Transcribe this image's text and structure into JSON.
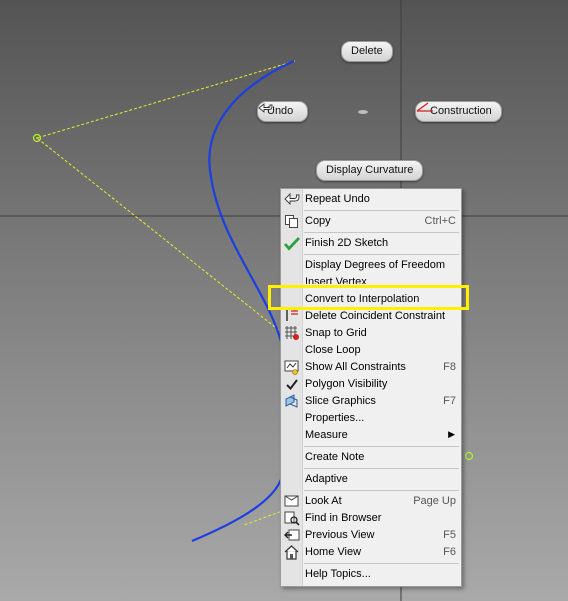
{
  "colors": {
    "curve": "#1b3fe0",
    "construction_line": "#e8ee2a",
    "highlight": "#ffef00",
    "check_green": "#2ea043",
    "construction_icon": "#d22020"
  },
  "marking_menu": {
    "delete": "Delete",
    "undo": "Undo",
    "construction": "Construction",
    "display_curvature": "Display Curvature"
  },
  "context_menu": {
    "items": [
      {
        "label": "Repeat Undo",
        "shortcut": "",
        "icon": "undo-arrow-icon"
      },
      {
        "label": "Copy",
        "shortcut": "Ctrl+C",
        "icon": "copy-icon"
      },
      {
        "label": "Finish 2D Sketch",
        "shortcut": "",
        "icon": "green-check-icon"
      },
      {
        "label": "Display Degrees of Freedom",
        "shortcut": "",
        "icon": ""
      },
      {
        "label": "Insert Vertex",
        "shortcut": "",
        "icon": ""
      },
      {
        "label": "Convert to Interpolation",
        "shortcut": "",
        "icon": ""
      },
      {
        "label": "Delete Coincident Constraint",
        "shortcut": "",
        "icon": "delete-constraint-icon"
      },
      {
        "label": "Snap to Grid",
        "shortcut": "",
        "icon": "snap-grid-icon"
      },
      {
        "label": "Close Loop",
        "shortcut": "",
        "icon": ""
      },
      {
        "label": "Show All Constraints",
        "shortcut": "F8",
        "icon": "show-constraints-icon"
      },
      {
        "label": "Polygon Visibility",
        "shortcut": "",
        "icon": "checkmark-icon"
      },
      {
        "label": "Slice Graphics",
        "shortcut": "F7",
        "icon": "slice-graphics-icon"
      },
      {
        "label": "Properties...",
        "shortcut": "",
        "icon": ""
      },
      {
        "label": "Measure",
        "shortcut": "",
        "icon": "submenu-arrow"
      },
      {
        "label": "Create Note",
        "shortcut": "",
        "icon": ""
      },
      {
        "label": "Adaptive",
        "shortcut": "",
        "icon": ""
      },
      {
        "label": "Look At",
        "shortcut": "Page Up",
        "icon": "look-at-icon"
      },
      {
        "label": "Find in Browser",
        "shortcut": "",
        "icon": "find-in-browser-icon"
      },
      {
        "label": "Previous View",
        "shortcut": "F5",
        "icon": "previous-view-icon"
      },
      {
        "label": "Home View",
        "shortcut": "F6",
        "icon": "home-icon"
      },
      {
        "label": "Help Topics...",
        "shortcut": "",
        "icon": ""
      }
    ]
  }
}
